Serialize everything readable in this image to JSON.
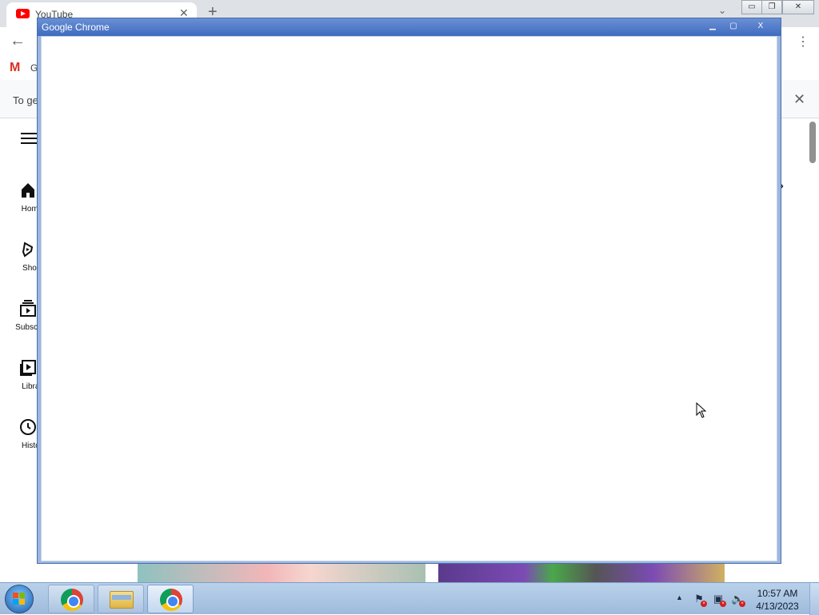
{
  "background_browser": {
    "tab": {
      "title": "YouTube",
      "close_glyph": "✕"
    },
    "new_tab_glyph": "+",
    "tab_search_glyph": "⌄",
    "window_controls": [
      "▭",
      "❐",
      "✕"
    ],
    "back_glyph": "←",
    "menu_glyph": "⋮",
    "bookmark": {
      "icon_letter": "M",
      "label": "G"
    },
    "infobar": {
      "text": "To ge",
      "close_glyph": "✕"
    },
    "sidebar": {
      "items": [
        {
          "label": "Home"
        },
        {
          "label": "Short"
        },
        {
          "label": "Subscript"
        },
        {
          "label": "Librar"
        },
        {
          "label": "Histor"
        }
      ]
    },
    "chevron_glyph": "›"
  },
  "popup": {
    "title": "Google Chrome",
    "controls": [
      "▁",
      "▢",
      "X"
    ]
  },
  "taskbar": {
    "clock_time": "10:57 AM",
    "clock_date": "4/13/2023",
    "tray_arrow": "▲"
  },
  "colors": {
    "popup_title": "#3f6cc0",
    "taskbar": "#b9d1ea",
    "youtube_red": "#ff0000"
  }
}
